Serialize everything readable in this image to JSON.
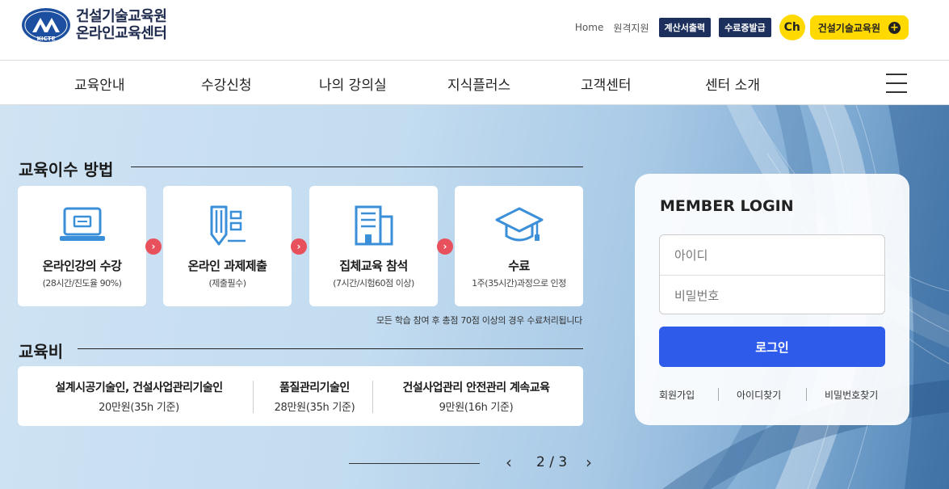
{
  "header": {
    "logo_line1": "건설기술교육원",
    "logo_line2": "온라인교육센터",
    "emblem_text": "KICTE",
    "util_links": [
      "Home",
      "원격지원"
    ],
    "util_buttons": [
      "계산서출력",
      "수료증발급"
    ],
    "channel_badge": "Ch",
    "channel_label": "건설기술교육원",
    "plus_symbol": "+"
  },
  "nav": {
    "items": [
      "교육안내",
      "수강신청",
      "나의 강의실",
      "지식플러스",
      "고객센터",
      "센터 소개"
    ]
  },
  "education": {
    "title": "교육이수 방법",
    "steps": [
      {
        "title": "온라인강의 수강",
        "sub": "(28시간/진도율 90%)",
        "icon": "monitor-icon"
      },
      {
        "title": "온라인 과제제출",
        "sub": "(제출필수)",
        "icon": "pencil-document-icon"
      },
      {
        "title": "집체교육 참석",
        "sub": "(7시간/시험60점 이상)",
        "icon": "building-icon"
      },
      {
        "title": "수료",
        "sub": "1주(35시간)과정으로 인정",
        "icon": "graduation-cap-icon"
      }
    ],
    "arrow_symbol": "›",
    "note": "모든 학습 참여 후 총점 70점 이상의 경우 수료처리됩니다"
  },
  "fees": {
    "title": "교육비",
    "items": [
      {
        "name": "설계시공기술인, 건설사업관리기술인",
        "price": "20만원(35h 기준)"
      },
      {
        "name": "품질관리기술인",
        "price": "28만원(35h 기준)"
      },
      {
        "name": "건설사업관리 안전관리 계속교육",
        "price": "9만원(16h 기준)"
      }
    ]
  },
  "pager": {
    "count": "2 / 3",
    "prev": "‹",
    "next": "›"
  },
  "login": {
    "title": "MEMBER LOGIN",
    "id_placeholder": "아이디",
    "pw_placeholder": "비밀번호",
    "button": "로그인",
    "links": [
      "회원가입",
      "아이디찾기",
      "비밀번호찾기"
    ]
  },
  "colors": {
    "navy": "#1d2f5c",
    "yellow": "#ffd900",
    "login_blue": "#2f5bea",
    "arrow_red": "#e8505b",
    "icon_blue": "#3a8fd8"
  }
}
